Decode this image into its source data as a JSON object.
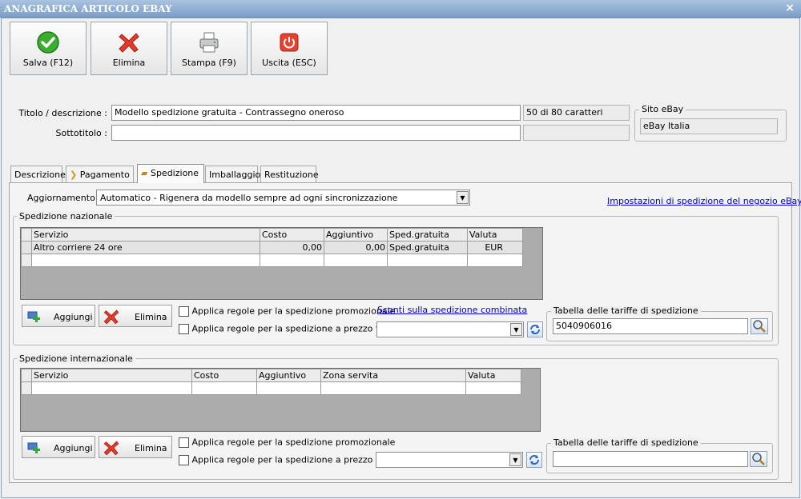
{
  "window": {
    "title": "ANAGRAFICA ARTICOLO EBAY",
    "close": "×"
  },
  "toolbar": {
    "save": "Salva (F12)",
    "delete": "Elimina",
    "print": "Stampa (F9)",
    "exit": "Uscita (ESC)"
  },
  "header": {
    "title_label": "Titolo / descrizione :",
    "title_value": "Modello spedizione gratuita - Contrassegno oneroso",
    "char_count": "50 di 80 caratteri",
    "subtitle_label": "Sottotitolo :",
    "subtitle_value": "",
    "site_legend": "Sito eBay",
    "site_value": "eBay Italia"
  },
  "tabs": [
    {
      "label": "Descrizione"
    },
    {
      "label": "Pagamento"
    },
    {
      "label": "Spedizione"
    },
    {
      "label": "Imballaggio"
    },
    {
      "label": "Restituzione"
    }
  ],
  "shipping": {
    "update_label": "Aggiornamento :",
    "update_value": "Automatico - Rigenera da modello sempre ad ogni sincronizzazione",
    "store_link": "Impostazioni di spedizione del negozio eBay",
    "national": {
      "legend": "Spedizione nazionale",
      "columns": [
        "Servizio",
        "Costo",
        "Aggiuntivo",
        "Sped.gratuita",
        "Valuta"
      ],
      "rows": [
        [
          "Altro corriere 24 ore",
          "0,00",
          "0,00",
          "Sped.gratuita",
          "EUR"
        ],
        [
          "",
          "",
          "",
          "",
          ""
        ]
      ],
      "add": "Aggiungi",
      "delete": "Elimina",
      "promo_check": "Applica regole per la spedizione promozionale",
      "fixed_check": "Applica regole per la spedizione a prezzo fisso",
      "combined_link": "Sconti sulla spedizione combinata",
      "rate_legend": "Tabella delle tariffe di spedizione",
      "rate_value": "5040906016"
    },
    "international": {
      "legend": "Spedizione internazionale",
      "columns": [
        "Servizio",
        "Costo",
        "Aggiuntivo",
        "Zona servita",
        "Valuta"
      ],
      "rows": [
        [
          "",
          "",
          "",
          "",
          ""
        ]
      ],
      "add": "Aggiungi",
      "delete": "Elimina",
      "promo_check": "Applica regole per la spedizione promozionale",
      "fixed_check": "Applica regole per la spedizione a prezzo fisso",
      "rate_legend": "Tabella delle tariffe di spedizione",
      "rate_value": ""
    }
  }
}
